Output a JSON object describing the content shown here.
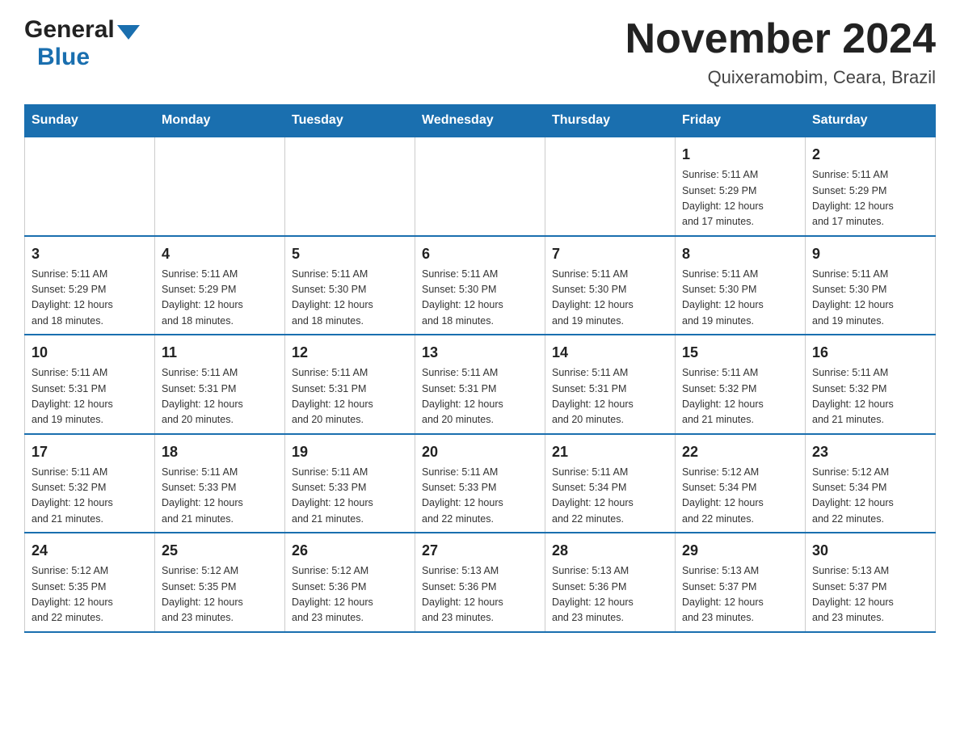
{
  "logo": {
    "general": "General",
    "blue": "Blue"
  },
  "header": {
    "month": "November 2024",
    "location": "Quixeramobim, Ceara, Brazil"
  },
  "weekdays": [
    "Sunday",
    "Monday",
    "Tuesday",
    "Wednesday",
    "Thursday",
    "Friday",
    "Saturday"
  ],
  "weeks": [
    [
      {
        "day": "",
        "info": ""
      },
      {
        "day": "",
        "info": ""
      },
      {
        "day": "",
        "info": ""
      },
      {
        "day": "",
        "info": ""
      },
      {
        "day": "",
        "info": ""
      },
      {
        "day": "1",
        "info": "Sunrise: 5:11 AM\nSunset: 5:29 PM\nDaylight: 12 hours\nand 17 minutes."
      },
      {
        "day": "2",
        "info": "Sunrise: 5:11 AM\nSunset: 5:29 PM\nDaylight: 12 hours\nand 17 minutes."
      }
    ],
    [
      {
        "day": "3",
        "info": "Sunrise: 5:11 AM\nSunset: 5:29 PM\nDaylight: 12 hours\nand 18 minutes."
      },
      {
        "day": "4",
        "info": "Sunrise: 5:11 AM\nSunset: 5:29 PM\nDaylight: 12 hours\nand 18 minutes."
      },
      {
        "day": "5",
        "info": "Sunrise: 5:11 AM\nSunset: 5:30 PM\nDaylight: 12 hours\nand 18 minutes."
      },
      {
        "day": "6",
        "info": "Sunrise: 5:11 AM\nSunset: 5:30 PM\nDaylight: 12 hours\nand 18 minutes."
      },
      {
        "day": "7",
        "info": "Sunrise: 5:11 AM\nSunset: 5:30 PM\nDaylight: 12 hours\nand 19 minutes."
      },
      {
        "day": "8",
        "info": "Sunrise: 5:11 AM\nSunset: 5:30 PM\nDaylight: 12 hours\nand 19 minutes."
      },
      {
        "day": "9",
        "info": "Sunrise: 5:11 AM\nSunset: 5:30 PM\nDaylight: 12 hours\nand 19 minutes."
      }
    ],
    [
      {
        "day": "10",
        "info": "Sunrise: 5:11 AM\nSunset: 5:31 PM\nDaylight: 12 hours\nand 19 minutes."
      },
      {
        "day": "11",
        "info": "Sunrise: 5:11 AM\nSunset: 5:31 PM\nDaylight: 12 hours\nand 20 minutes."
      },
      {
        "day": "12",
        "info": "Sunrise: 5:11 AM\nSunset: 5:31 PM\nDaylight: 12 hours\nand 20 minutes."
      },
      {
        "day": "13",
        "info": "Sunrise: 5:11 AM\nSunset: 5:31 PM\nDaylight: 12 hours\nand 20 minutes."
      },
      {
        "day": "14",
        "info": "Sunrise: 5:11 AM\nSunset: 5:31 PM\nDaylight: 12 hours\nand 20 minutes."
      },
      {
        "day": "15",
        "info": "Sunrise: 5:11 AM\nSunset: 5:32 PM\nDaylight: 12 hours\nand 21 minutes."
      },
      {
        "day": "16",
        "info": "Sunrise: 5:11 AM\nSunset: 5:32 PM\nDaylight: 12 hours\nand 21 minutes."
      }
    ],
    [
      {
        "day": "17",
        "info": "Sunrise: 5:11 AM\nSunset: 5:32 PM\nDaylight: 12 hours\nand 21 minutes."
      },
      {
        "day": "18",
        "info": "Sunrise: 5:11 AM\nSunset: 5:33 PM\nDaylight: 12 hours\nand 21 minutes."
      },
      {
        "day": "19",
        "info": "Sunrise: 5:11 AM\nSunset: 5:33 PM\nDaylight: 12 hours\nand 21 minutes."
      },
      {
        "day": "20",
        "info": "Sunrise: 5:11 AM\nSunset: 5:33 PM\nDaylight: 12 hours\nand 22 minutes."
      },
      {
        "day": "21",
        "info": "Sunrise: 5:11 AM\nSunset: 5:34 PM\nDaylight: 12 hours\nand 22 minutes."
      },
      {
        "day": "22",
        "info": "Sunrise: 5:12 AM\nSunset: 5:34 PM\nDaylight: 12 hours\nand 22 minutes."
      },
      {
        "day": "23",
        "info": "Sunrise: 5:12 AM\nSunset: 5:34 PM\nDaylight: 12 hours\nand 22 minutes."
      }
    ],
    [
      {
        "day": "24",
        "info": "Sunrise: 5:12 AM\nSunset: 5:35 PM\nDaylight: 12 hours\nand 22 minutes."
      },
      {
        "day": "25",
        "info": "Sunrise: 5:12 AM\nSunset: 5:35 PM\nDaylight: 12 hours\nand 23 minutes."
      },
      {
        "day": "26",
        "info": "Sunrise: 5:12 AM\nSunset: 5:36 PM\nDaylight: 12 hours\nand 23 minutes."
      },
      {
        "day": "27",
        "info": "Sunrise: 5:13 AM\nSunset: 5:36 PM\nDaylight: 12 hours\nand 23 minutes."
      },
      {
        "day": "28",
        "info": "Sunrise: 5:13 AM\nSunset: 5:36 PM\nDaylight: 12 hours\nand 23 minutes."
      },
      {
        "day": "29",
        "info": "Sunrise: 5:13 AM\nSunset: 5:37 PM\nDaylight: 12 hours\nand 23 minutes."
      },
      {
        "day": "30",
        "info": "Sunrise: 5:13 AM\nSunset: 5:37 PM\nDaylight: 12 hours\nand 23 minutes."
      }
    ]
  ]
}
